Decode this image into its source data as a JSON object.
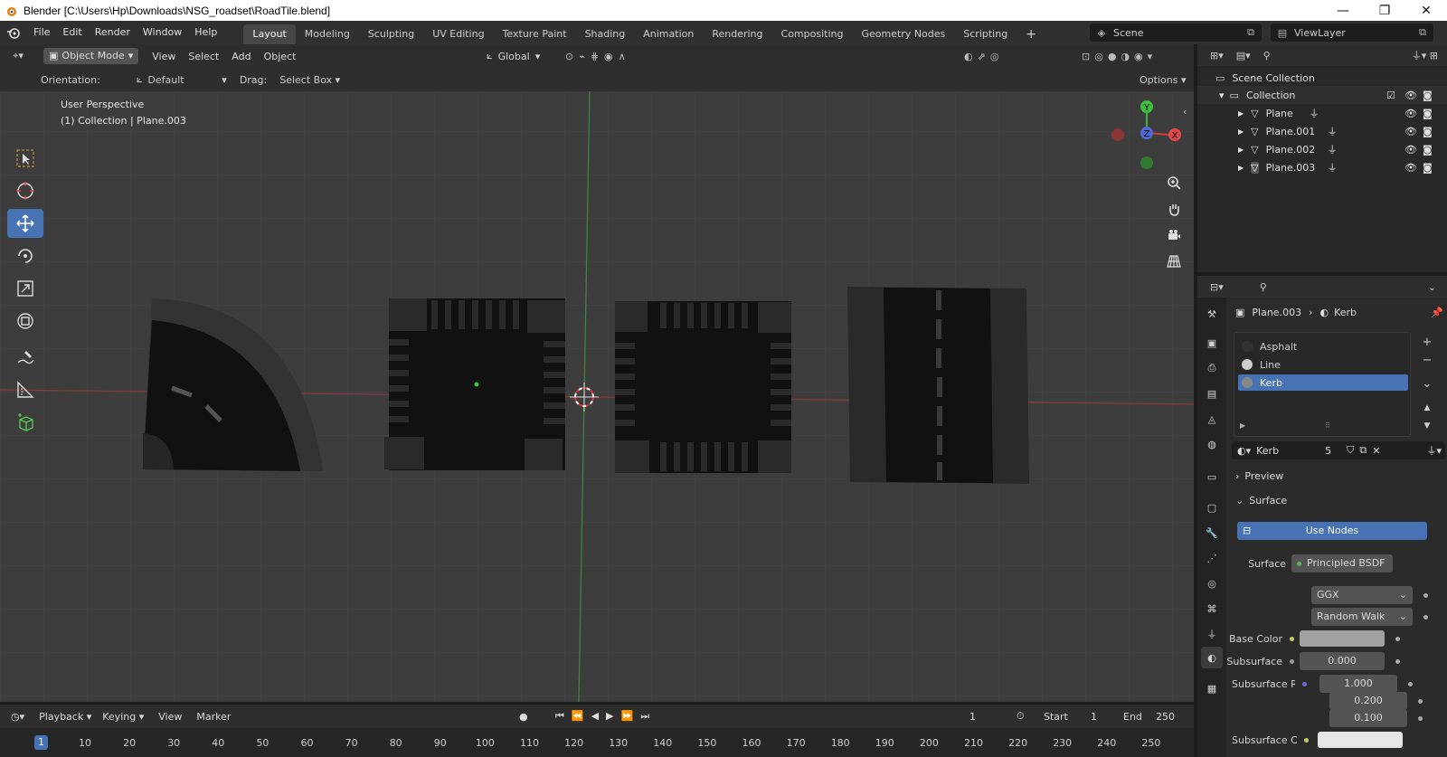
{
  "window": {
    "title": "Blender [C:\\Users\\Hp\\Downloads\\NSG_roadset\\RoadTile.blend]",
    "minimize": "—",
    "maximize": "❐",
    "close": "✕"
  },
  "menu": [
    "File",
    "Edit",
    "Render",
    "Window",
    "Help"
  ],
  "workspaces": [
    "Layout",
    "Modeling",
    "Sculpting",
    "UV Editing",
    "Texture Paint",
    "Shading",
    "Animation",
    "Rendering",
    "Compositing",
    "Geometry Nodes",
    "Scripting"
  ],
  "workspace_add": "+",
  "scene": {
    "label": "Scene",
    "viewlayer": "ViewLayer"
  },
  "viewport": {
    "mode": "Object Mode",
    "menus": [
      "View",
      "Select",
      "Add",
      "Object"
    ],
    "transform_orientation": "Global",
    "orientation_label": "Orientation:",
    "orientation_value": "Default",
    "drag_label": "Drag:",
    "drag_value": "Select Box",
    "options": "Options",
    "overlay_line1": "User Perspective",
    "overlay_line2": "(1) Collection | Plane.003",
    "gizmo": {
      "x": "X",
      "y": "Y",
      "z": "Z"
    }
  },
  "outliner": {
    "scene_collection": "Scene Collection",
    "collection": "Collection",
    "objects": [
      "Plane",
      "Plane.001",
      "Plane.002",
      "Plane.003"
    ]
  },
  "properties": {
    "breadcrumb_object": "Plane.003",
    "breadcrumb_material": "Kerb",
    "materials": [
      "Asphalt",
      "Line",
      "Kerb"
    ],
    "selected_material": "Kerb",
    "material_name": "Kerb",
    "material_users": "5",
    "panels": {
      "preview": "Preview",
      "surface": "Surface"
    },
    "use_nodes": "Use Nodes",
    "surface_label": "Surface",
    "surface_value": "Principled BSDF",
    "distribution": "GGX",
    "subsurface_method": "Random Walk",
    "base_color_label": "Base Color",
    "subsurface_label": "Subsurface",
    "subsurface_value": "0.000",
    "subsurface_radius_label": "Subsurface Ra",
    "subsurface_radius": [
      "1.000",
      "0.200",
      "0.100"
    ],
    "subsurface_color_label": "Subsurface Co",
    "colors": {
      "highlight": "#4772b3",
      "base_color": "#a0a0a0"
    }
  },
  "timeline": {
    "menus": [
      "Playback",
      "Keying",
      "View",
      "Marker"
    ],
    "current_frame": "1",
    "start_label": "Start",
    "start": "1",
    "end_label": "End",
    "end": "250",
    "ruler": [
      "1",
      "10",
      "20",
      "30",
      "40",
      "50",
      "60",
      "70",
      "80",
      "90",
      "100",
      "110",
      "120",
      "130",
      "140",
      "150",
      "160",
      "170",
      "180",
      "190",
      "200",
      "210",
      "220",
      "230",
      "240",
      "250"
    ]
  }
}
